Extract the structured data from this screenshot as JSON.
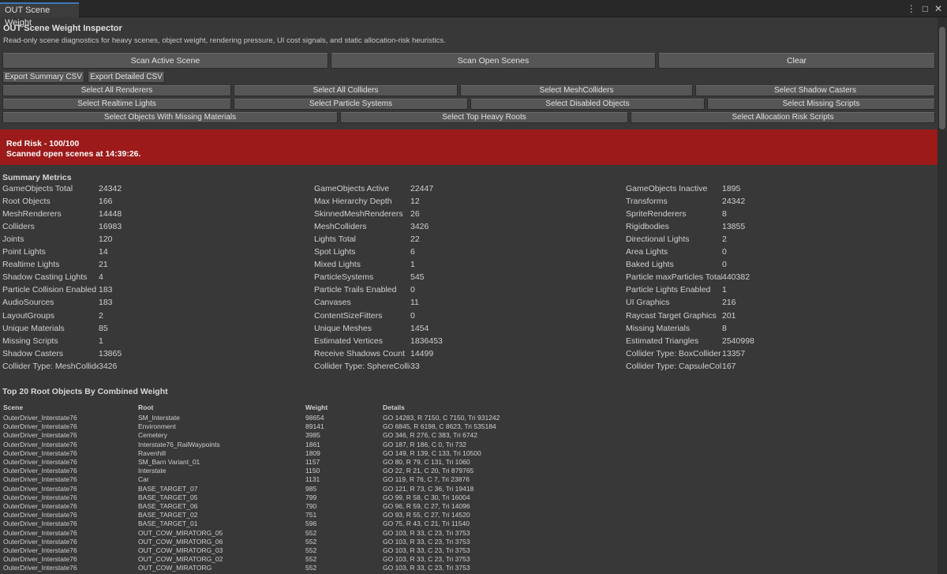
{
  "window": {
    "tab_label": "OUT Scene Weight",
    "menu_icon": "kebab-menu-icon",
    "maximize_icon": "maximize-icon",
    "close_icon": "close-icon"
  },
  "inspector": {
    "title": "OUT Scene Weight Inspector",
    "description": "Read-only scene diagnostics for heavy scenes, object weight, rendering pressure, UI cost signals, and static allocation-risk heuristics."
  },
  "actions": {
    "scan_active": "Scan Active Scene",
    "scan_open": "Scan Open Scenes",
    "clear": "Clear",
    "export_summary": "Export Summary CSV",
    "export_detailed": "Export Detailed CSV"
  },
  "select_buttons": {
    "row1": [
      "Select All Renderers",
      "Select All Colliders",
      "Select MeshColliders",
      "Select Shadow Casters"
    ],
    "row2": [
      "Select Realtime Lights",
      "Select Particle Systems",
      "Select Disabled Objects",
      "Select Missing Scripts"
    ],
    "row3": [
      "Select Objects With Missing Materials",
      "Select Top Heavy Roots",
      "Select Allocation Risk Scripts"
    ]
  },
  "risk": {
    "level": "Red Risk - 100/100",
    "status": "Scanned open scenes at 14:39:26.",
    "color": "#9c1a1a"
  },
  "summary": {
    "title": "Summary Metrics",
    "col1": [
      {
        "label": "GameObjects Total",
        "value": "24342"
      },
      {
        "label": "Root Objects",
        "value": "166"
      },
      {
        "label": "MeshRenderers",
        "value": "14448"
      },
      {
        "label": "Colliders",
        "value": "16983"
      },
      {
        "label": "Joints",
        "value": "120"
      },
      {
        "label": "Point Lights",
        "value": "14"
      },
      {
        "label": "Realtime Lights",
        "value": "21"
      },
      {
        "label": "Shadow Casting Lights",
        "value": "4"
      },
      {
        "label": "Particle Collision Enabled",
        "value": "183"
      },
      {
        "label": "AudioSources",
        "value": "183"
      },
      {
        "label": "LayoutGroups",
        "value": "2"
      },
      {
        "label": "Unique Materials",
        "value": "85"
      },
      {
        "label": "Missing Scripts",
        "value": "1"
      },
      {
        "label": "Shadow Casters",
        "value": "13865"
      },
      {
        "label": "Collider Type: MeshCollider",
        "value": "3426"
      }
    ],
    "col2": [
      {
        "label": "GameObjects Active",
        "value": "22447"
      },
      {
        "label": "Max Hierarchy Depth",
        "value": "12"
      },
      {
        "label": "SkinnedMeshRenderers",
        "value": "26"
      },
      {
        "label": "MeshColliders",
        "value": "3426"
      },
      {
        "label": "Lights Total",
        "value": "22"
      },
      {
        "label": "Spot Lights",
        "value": "6"
      },
      {
        "label": "Mixed Lights",
        "value": "1"
      },
      {
        "label": "ParticleSystems",
        "value": "545"
      },
      {
        "label": "Particle Trails Enabled",
        "value": "0"
      },
      {
        "label": "Canvases",
        "value": "11"
      },
      {
        "label": "ContentSizeFitters",
        "value": "0"
      },
      {
        "label": "Unique Meshes",
        "value": "1454"
      },
      {
        "label": "Estimated Vertices",
        "value": "1836453"
      },
      {
        "label": "Receive Shadows Count",
        "value": "14499"
      },
      {
        "label": "Collider Type: SphereCollider",
        "value": "33"
      }
    ],
    "col3": [
      {
        "label": "GameObjects Inactive",
        "value": "1895"
      },
      {
        "label": "Transforms",
        "value": "24342"
      },
      {
        "label": "SpriteRenderers",
        "value": "8"
      },
      {
        "label": "Rigidbodies",
        "value": "13855"
      },
      {
        "label": "Directional Lights",
        "value": "2"
      },
      {
        "label": "Area Lights",
        "value": "0"
      },
      {
        "label": "Baked Lights",
        "value": "0"
      },
      {
        "label": "Particle maxParticles Total",
        "value": "440382"
      },
      {
        "label": "Particle Lights Enabled",
        "value": "1"
      },
      {
        "label": "UI Graphics",
        "value": "216"
      },
      {
        "label": "Raycast Target Graphics",
        "value": "201"
      },
      {
        "label": "Missing Materials",
        "value": "8"
      },
      {
        "label": "Estimated Triangles",
        "value": "2540998"
      },
      {
        "label": "Collider Type: BoxCollider",
        "value": "13357"
      },
      {
        "label": "Collider Type: CapsuleCollider",
        "value": "167"
      }
    ]
  },
  "top_roots": {
    "title": "Top 20 Root Objects By Combined Weight",
    "headers": [
      "Scene",
      "Root",
      "Weight",
      "Details"
    ],
    "rows": [
      [
        "OuterDriver_Interstate76",
        "SM_Interstate",
        "98654",
        "GO 14283, R 7150, C 7150, Tri 931242"
      ],
      [
        "OuterDriver_Interstate76",
        "Environment",
        "89141",
        "GO 6845, R 6198, C 8623, Tri 535184"
      ],
      [
        "OuterDriver_Interstate76",
        "Cemetery",
        "3985",
        "GO 346, R 276, C 383, Tri 6742"
      ],
      [
        "OuterDriver_Interstate76",
        "Interstate76_RailWaypoints",
        "1861",
        "GO 187, R 186, C 0, Tri 732"
      ],
      [
        "OuterDriver_Interstate76",
        "Ravenhill",
        "1809",
        "GO 149, R 139, C 133, Tri 10500"
      ],
      [
        "OuterDriver_Interstate76",
        "SM_Barn Variant_01",
        "1157",
        "GO 80, R 79, C 131, Tri 1060"
      ],
      [
        "OuterDriver_Interstate76",
        "Interstate",
        "1150",
        "GO 22, R 21, C 20, Tri 879765"
      ],
      [
        "OuterDriver_Interstate76",
        "Car",
        "1131",
        "GO 119, R 76, C 7, Tri 23876"
      ],
      [
        "OuterDriver_Interstate76",
        "BASE_TARGET_07",
        "985",
        "GO 121, R 73, C 36, Tri 19418"
      ],
      [
        "OuterDriver_Interstate76",
        "BASE_TARGET_05",
        "799",
        "GO 99, R 58, C 30, Tri 16004"
      ],
      [
        "OuterDriver_Interstate76",
        "BASE_TARGET_06",
        "790",
        "GO 96, R 59, C 27, Tri 14096"
      ],
      [
        "OuterDriver_Interstate76",
        "BASE_TARGET_02",
        "751",
        "GO 93, R 55, C 27, Tri 14520"
      ],
      [
        "OuterDriver_Interstate76",
        "BASE_TARGET_01",
        "596",
        "GO 75, R 43, C 21, Tri 11540"
      ],
      [
        "OuterDriver_Interstate76",
        "OUT_COW_MIRATORG_05",
        "552",
        "GO 103, R 33, C 23, Tri 3753"
      ],
      [
        "OuterDriver_Interstate76",
        "OUT_COW_MIRATORG_06",
        "552",
        "GO 103, R 33, C 23, Tri 3753"
      ],
      [
        "OuterDriver_Interstate76",
        "OUT_COW_MIRATORG_03",
        "552",
        "GO 103, R 33, C 23, Tri 3753"
      ],
      [
        "OuterDriver_Interstate76",
        "OUT_COW_MIRATORG_02",
        "552",
        "GO 103, R 33, C 23, Tri 3753"
      ],
      [
        "OuterDriver_Interstate76",
        "OUT_COW_MIRATORG",
        "552",
        "GO 103, R 33, C 23, Tri 3753"
      ]
    ]
  }
}
